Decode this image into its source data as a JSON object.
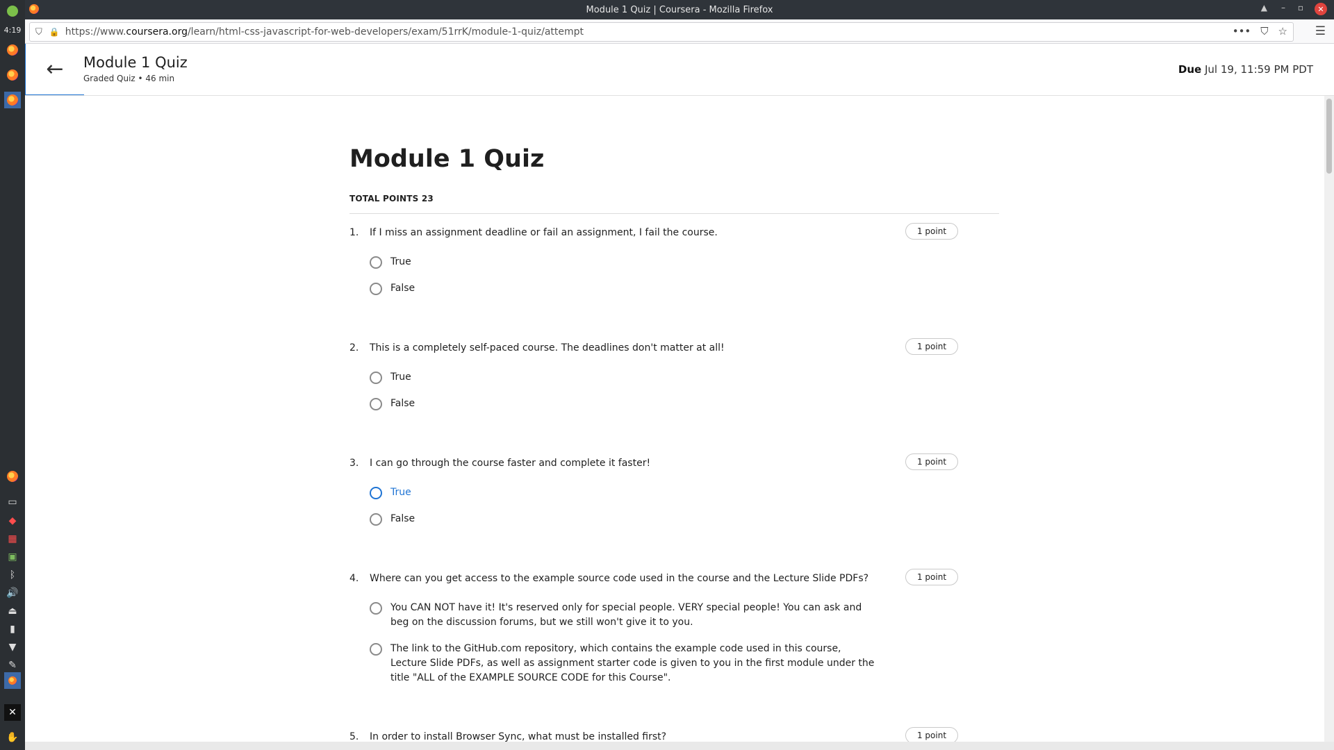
{
  "system": {
    "clock": "4:19"
  },
  "window": {
    "title": "Module 1 Quiz | Coursera - Mozilla Firefox"
  },
  "browser": {
    "url_prefix": "https://www.",
    "url_host": "coursera.org",
    "url_path": "/learn/html-css-javascript-for-web-developers/exam/51rrK/module-1-quiz/attempt"
  },
  "header": {
    "title": "Module 1 Quiz",
    "subtitle": "Graded Quiz • 46 min",
    "due_label": "Due",
    "due_value": "Jul 19, 11:59 PM PDT"
  },
  "quiz": {
    "title": "Module 1 Quiz",
    "total_points": "TOTAL POINTS 23",
    "questions": [
      {
        "number": "1.",
        "text": "If I miss an assignment deadline or fail an assignment, I fail the course.",
        "points": "1 point",
        "options": [
          "True",
          "False"
        ]
      },
      {
        "number": "2.",
        "text": "This is a completely self-paced course. The deadlines don't matter at all!",
        "points": "1 point",
        "options": [
          "True",
          "False"
        ]
      },
      {
        "number": "3.",
        "text": "I can go through the course faster and complete it faster!",
        "points": "1 point",
        "options": [
          "True",
          "False"
        ]
      },
      {
        "number": "4.",
        "text": "Where can you get access to the example source code used in the course and the Lecture Slide PDFs?",
        "points": "1 point",
        "options": [
          "You CAN NOT have it! It's reserved only for special people. VERY special people! You can ask and beg on the discussion forums, but we still won't give it to you.",
          "The link to the GitHub.com repository, which contains the example code used in this course, Lecture Slide PDFs, as well as assignment starter code is given to you in the first module under the title \"ALL of the EXAMPLE SOURCE CODE for this Course\"."
        ]
      },
      {
        "number": "5.",
        "text": "In order to install Browser Sync, what must be installed first?",
        "points": "1 point"
      }
    ]
  },
  "colors": {
    "accent": "#1f74d4",
    "dock": "#2b2f33",
    "titlebar": "#2f343a"
  },
  "icons": {
    "back": "arrow-left-icon",
    "lock": "lock-icon",
    "shield": "shield-icon",
    "menu": "hamburger-icon"
  }
}
